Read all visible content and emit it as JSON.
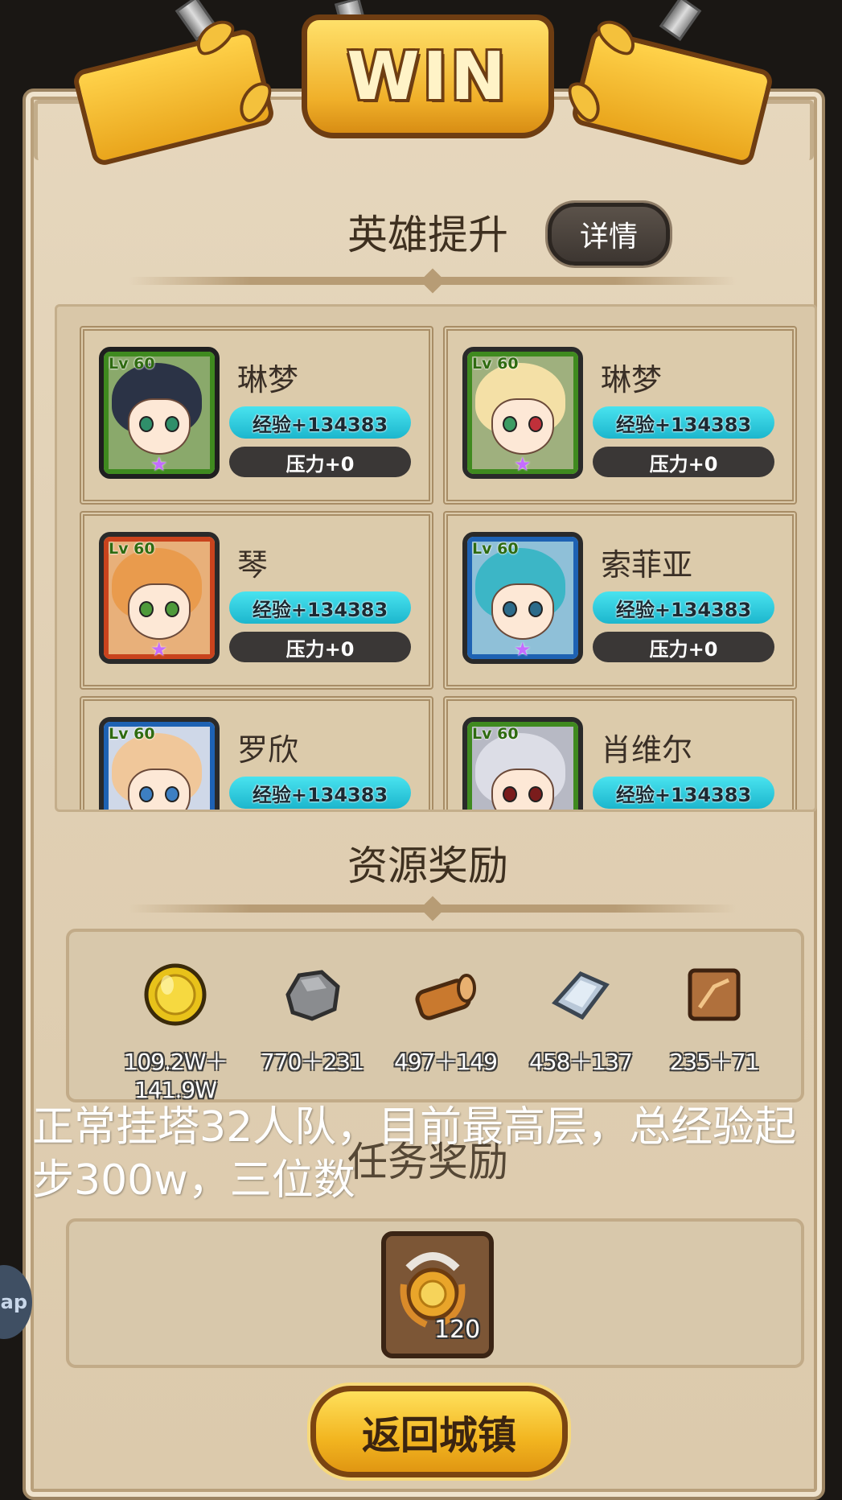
{
  "banner": {
    "title": "WIN"
  },
  "hero_section": {
    "title": "英雄提升",
    "detail_button": "详情",
    "heroes": [
      {
        "name": "琳梦",
        "level": "Lv 60",
        "exp": "经验+134383",
        "pressure": "压力+0",
        "frame_color": "#3f8a1f",
        "hair_color": "#2b3346",
        "eye_color": "#2f8f6a"
      },
      {
        "name": "琳梦",
        "level": "Lv 60",
        "exp": "经验+134383",
        "pressure": "压力+0",
        "frame_color": "#3f8a1f",
        "hair_color": "#f4e0a6",
        "eye_color": "#3c9c63"
      },
      {
        "name": "琴",
        "level": "Lv 60",
        "exp": "经验+134383",
        "pressure": "压力+0",
        "frame_color": "#c9431d",
        "hair_color": "#e99b4d",
        "eye_color": "#4e9a3a"
      },
      {
        "name": "索菲亚",
        "level": "Lv 60",
        "exp": "经验+134383",
        "pressure": "压力+0",
        "frame_color": "#1e62b3",
        "hair_color": "#3cb6c6",
        "eye_color": "#2c6b8a"
      },
      {
        "name": "罗欣",
        "level": "Lv 60",
        "exp": "经验+134383",
        "pressure": "",
        "frame_color": "#1e62b3",
        "hair_color": "#f0c79a",
        "eye_color": "#3d7fc2"
      },
      {
        "name": "肖维尔",
        "level": "Lv 60",
        "exp": "经验+134383",
        "pressure": "",
        "frame_color": "#3f8a1f",
        "hair_color": "#dcdde6",
        "eye_color": "#7a1c1c"
      }
    ]
  },
  "resource_section": {
    "title": "资源奖励",
    "items": [
      {
        "icon": "gold-coin-icon",
        "value": "109.2W＋141.9W"
      },
      {
        "icon": "stone-ore-icon",
        "value": "770＋231"
      },
      {
        "icon": "wood-log-icon",
        "value": "497＋149"
      },
      {
        "icon": "iron-ingot-icon",
        "value": "458＋137"
      },
      {
        "icon": "leather-hide-icon",
        "value": "235＋71"
      }
    ]
  },
  "task_section": {
    "title": "任务奖励",
    "reward": {
      "icon": "laurel-medal-icon",
      "count": "120"
    }
  },
  "return_button": "返回城镇",
  "caption": "正常挂塔32人队，目前最高层，总经验起步300w，三位数",
  "side_bubble": "ap"
}
